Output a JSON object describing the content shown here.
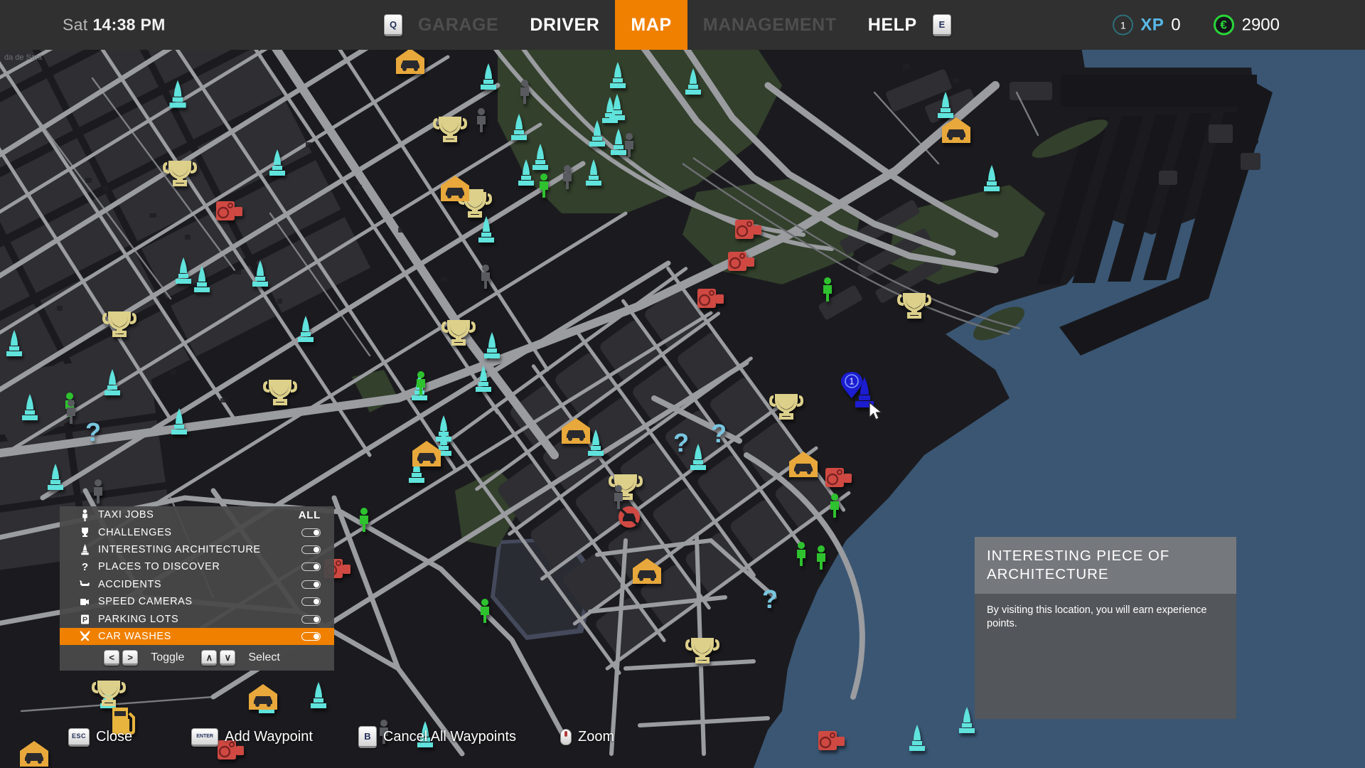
{
  "topbar": {
    "clock_day": "Sat",
    "clock_time": "14:38 PM",
    "quick_key": "Q",
    "help_key": "E",
    "nav": [
      {
        "label": "GARAGE",
        "state": "dim"
      },
      {
        "label": "DRIVER",
        "state": "on"
      },
      {
        "label": "MAP",
        "state": "selected"
      },
      {
        "label": "MANAGEMENT",
        "state": "dim"
      },
      {
        "label": "HELP",
        "state": "on"
      }
    ],
    "level": "1",
    "xp_label": "XP",
    "xp_value": "0",
    "currency_symbol": "€",
    "money_value": "2900",
    "accent_color": "#f08000",
    "xp_color": "#59b9e8",
    "money_color": "#2bd63a"
  },
  "filter_panel": {
    "all_label": "ALL",
    "rows": [
      {
        "icon": "pedestrian-icon",
        "label": "TAXI JOBS",
        "control": "all",
        "toggle_on": true,
        "active": false
      },
      {
        "icon": "trophy-icon",
        "label": "CHALLENGES",
        "control": "toggle",
        "toggle_on": true,
        "active": false
      },
      {
        "icon": "monument-icon",
        "label": "INTERESTING ARCHITECTURE",
        "control": "toggle",
        "toggle_on": true,
        "active": false
      },
      {
        "icon": "question-mark-icon",
        "label": "PLACES TO DISCOVER",
        "control": "toggle",
        "toggle_on": true,
        "active": false
      },
      {
        "icon": "crashed-car-icon",
        "label": "ACCIDENTS",
        "control": "toggle",
        "toggle_on": true,
        "active": false
      },
      {
        "icon": "speed-camera-icon",
        "label": "SPEED CAMERAS",
        "control": "toggle",
        "toggle_on": true,
        "active": false
      },
      {
        "icon": "parking-icon",
        "label": "PARKING LOTS",
        "control": "toggle",
        "toggle_on": true,
        "active": false
      },
      {
        "icon": "wrench-icon",
        "label": "CAR WASHES",
        "control": "toggle",
        "toggle_on": true,
        "active": true
      }
    ],
    "footer": {
      "toggle_label": "Toggle",
      "select_label": "Select",
      "left_key": "<",
      "right_key": ">",
      "up_key": "∧",
      "down_key": "∨"
    }
  },
  "info_card": {
    "title": "INTERESTING PIECE OF ARCHITECTURE",
    "body": "By visiting this location, you will earn experience points."
  },
  "hints": [
    {
      "key": "ESC",
      "key_style": "esc",
      "label": "Close"
    },
    {
      "key": "ENTER",
      "key_style": "enter",
      "label": "Add Waypoint"
    },
    {
      "key": "B",
      "key_style": "b",
      "label": "Cancel All Waypoints"
    },
    {
      "key": "mouse-wheel-icon",
      "key_style": "mouse",
      "label": "Zoom"
    }
  ],
  "map": {
    "colors": {
      "water": "#3a5673",
      "land": "#1b1b1f",
      "block": "#2e2e33",
      "road": "#9a9ca0",
      "road_minor": "#6e7074",
      "park": "#33402c",
      "architecture_marker": "#5fe3dc",
      "challenge_marker": "#ddd08a",
      "taxi_marker": "#e8a83a",
      "camera_marker": "#cf4a42",
      "job_marker": "#2fc22f",
      "inactive_marker": "#595a5e",
      "discover_marker": "#79c6e0",
      "waypoint_marker": "#1a1ed0"
    },
    "street_label": "da de Sant",
    "waypoint_number": "1",
    "selected_marker": "interesting-architecture"
  }
}
